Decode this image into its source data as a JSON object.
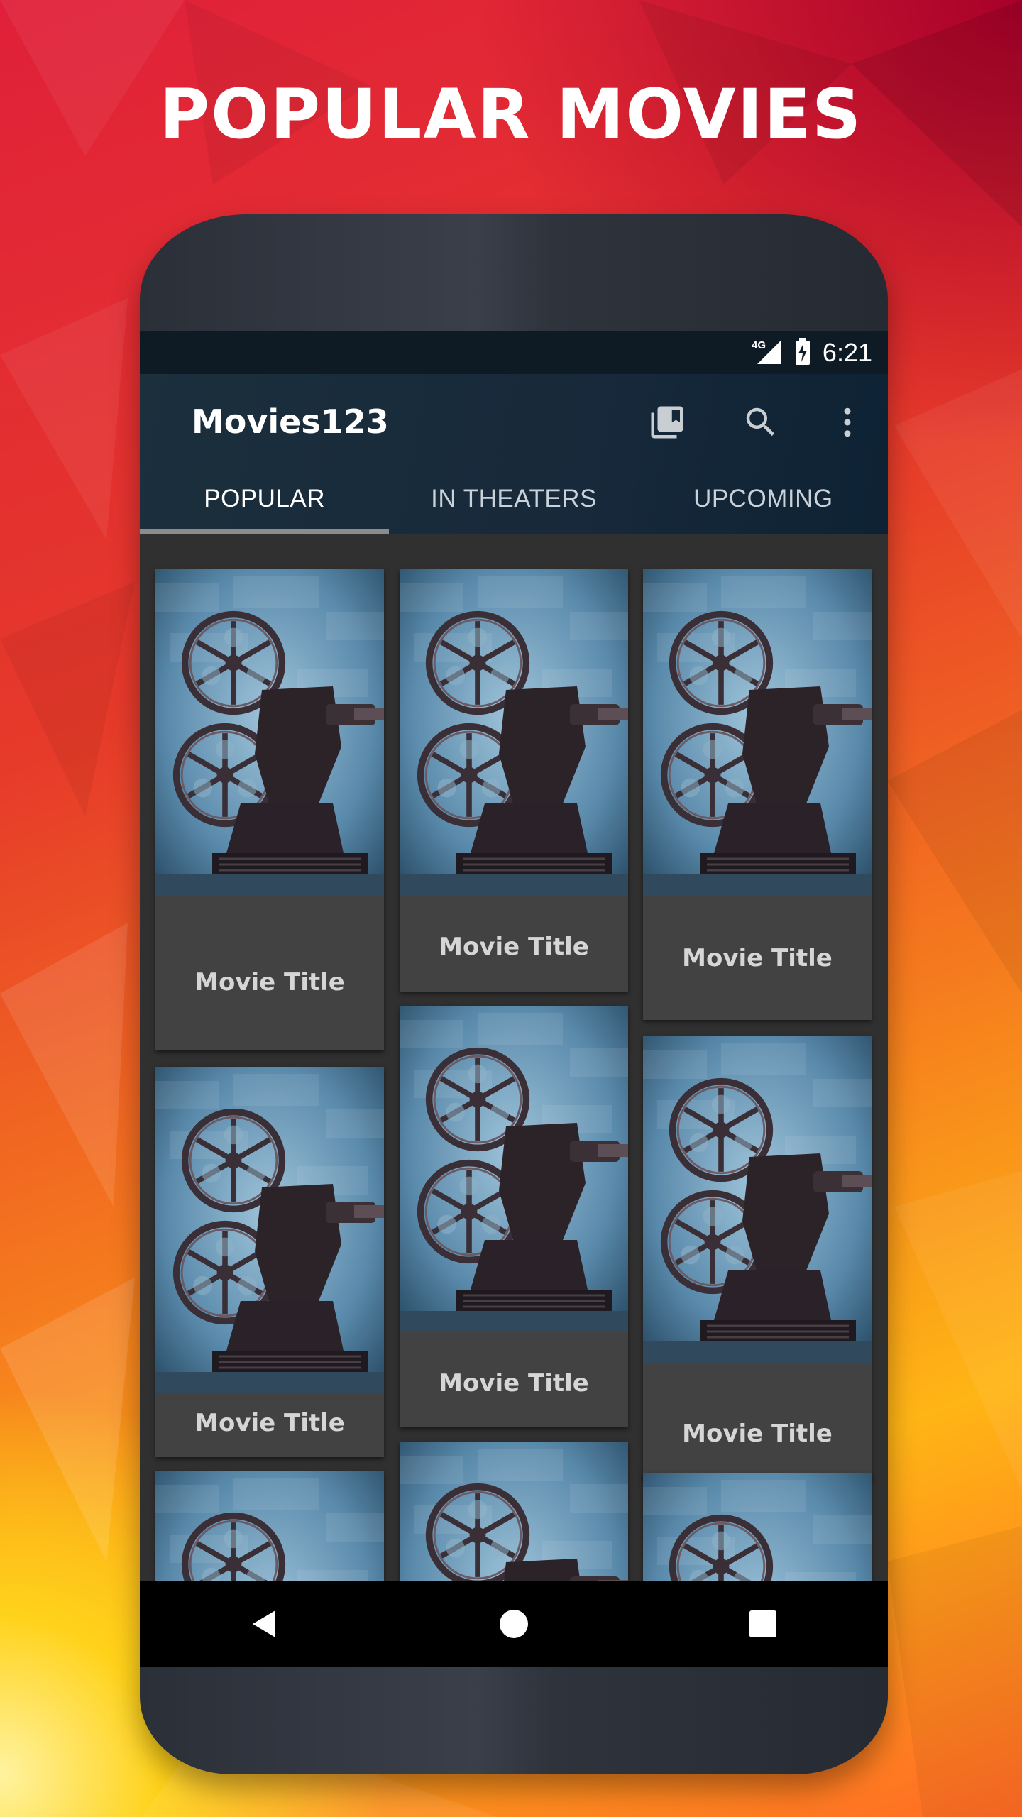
{
  "banner": {
    "headline": "POPULAR MOVIES"
  },
  "status_bar": {
    "network": "4G",
    "time": "6:21"
  },
  "app_bar": {
    "title": "Movies123",
    "icons": [
      "library-icon",
      "search-icon",
      "overflow-menu-icon"
    ]
  },
  "tabs": [
    {
      "label": "POPULAR",
      "active": true
    },
    {
      "label": "IN THEATERS",
      "active": false
    },
    {
      "label": "UPCOMING",
      "active": false
    }
  ],
  "movies": [
    {
      "title": "Movie Title"
    },
    {
      "title": "Movie Title"
    },
    {
      "title": "Movie Title"
    },
    {
      "title": "Movie Title"
    },
    {
      "title": "Movie Title"
    },
    {
      "title": "Movie Title"
    }
  ],
  "nav_bar": {
    "buttons": [
      "back-icon",
      "home-icon",
      "recents-icon"
    ]
  },
  "colors": {
    "app_bar": "#17293a",
    "status_bar": "#0e1a24",
    "content_bg": "#303030",
    "card_bg": "#424242",
    "card_text": "#d6d6d6"
  }
}
